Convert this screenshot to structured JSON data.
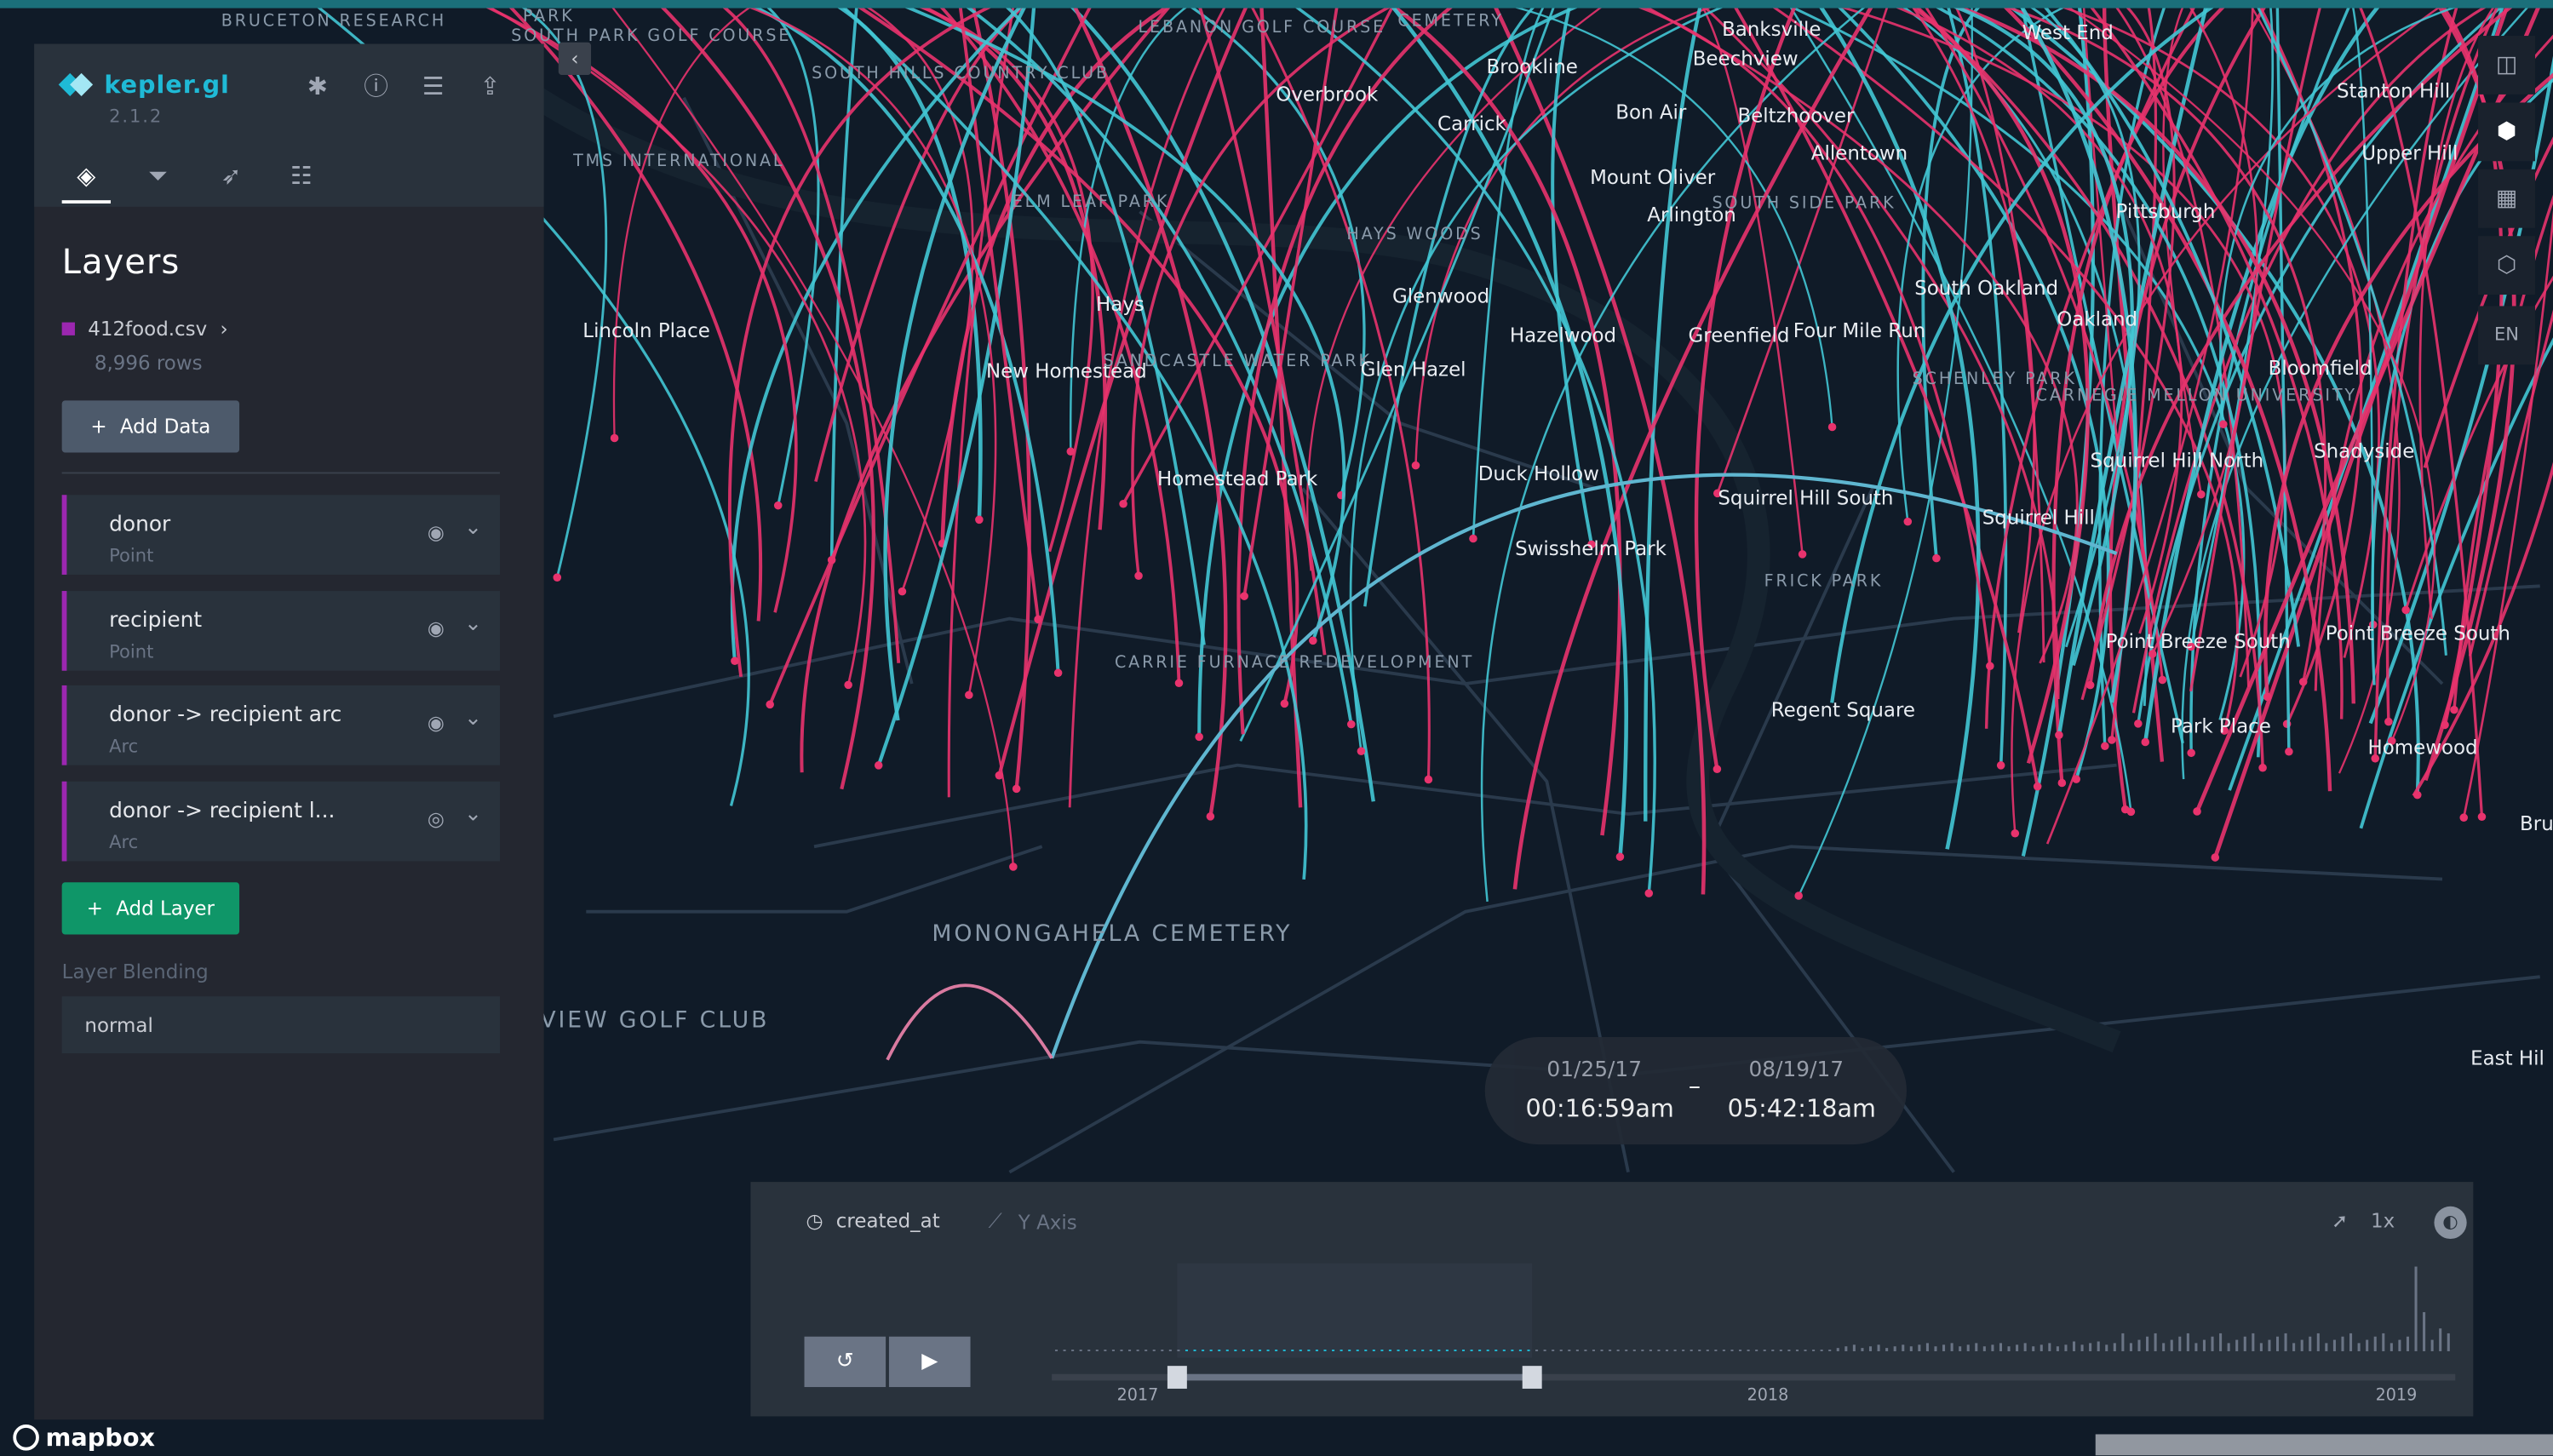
{
  "app": {
    "name": "kepler.gl",
    "version": "2.1.2"
  },
  "panel": {
    "title": "Layers",
    "tabs": [
      {
        "name": "layers-tab",
        "icon": "layers-icon"
      },
      {
        "name": "filters-tab",
        "icon": "filter-icon"
      },
      {
        "name": "interactions-tab",
        "icon": "cursor-icon"
      },
      {
        "name": "map-style-tab",
        "icon": "sliders-icon"
      }
    ],
    "dataset": {
      "name": "412food.csv",
      "rows": "8,996 rows",
      "color": "#9c27b0"
    },
    "add_data_label": "Add Data",
    "layers": [
      {
        "name": "donor",
        "type": "Point"
      },
      {
        "name": "recipient",
        "type": "Point"
      },
      {
        "name": "donor -> recipient arc",
        "type": "Arc"
      },
      {
        "name": "donor -> recipient l...",
        "type": "Arc"
      }
    ],
    "add_layer_label": "Add Layer",
    "blending_label": "Layer Blending",
    "blending_value": "normal"
  },
  "map_controls": [
    "split-map-icon",
    "3d-view-icon",
    "legend-icon",
    "draw-icon"
  ],
  "locale": "EN",
  "time_display": {
    "start_date": "01/25/17",
    "start_time": "00:16:59am",
    "end_date": "08/19/17",
    "end_time": "05:42:18am",
    "separator": "–"
  },
  "timeline": {
    "field": "created_at",
    "y_axis": "Y Axis",
    "speed": "1x",
    "years": [
      "2017",
      "2018",
      "2019"
    ]
  },
  "map_labels": [
    "BRUCETON RESEARCH",
    "PARK",
    "SOUTH PARK GOLF COURSE",
    "SOUTH HILLS COUNTRY CLUB",
    "LEBANON GOLF COURSE",
    "CEMETERY",
    "Brookline",
    "Banksville",
    "Beechview",
    "West End",
    "Overbrook",
    "Carrick",
    "Bon Air",
    "Beltzhoover",
    "TMS INTERNATIONAL",
    "Allentown",
    "Mount Oliver",
    "Arlington",
    "SOUTH SIDE PARK",
    "Pittsburgh",
    "ELM LEAF PARK",
    "HAYS WOODS",
    "Hays",
    "Glenwood",
    "Hazelwood",
    "Greenfield",
    "Four Mile Run",
    "Lincoln Place",
    "New Homestead",
    "SANDCASTLE WATER PARK",
    "Glen Hazel",
    "Homestead Park",
    "Duck Hollow",
    "Squirrel Hill South",
    "Squirrel Hill",
    "Swisshelm Park",
    "FRICK PARK",
    "CARRIE FURNACE REDEVELOPMENT",
    "Regent Square",
    "Point Breeze South",
    "Park Place",
    "Point Breeze South",
    "Homewood",
    "South Oakland",
    "Oakland",
    "SCHENLEY PARK",
    "CARNEGIE MELLON UNIVERSITY",
    "Bloomfield",
    "Squirrel Hill North",
    "Shadyside",
    "MONONGAHELA CEMETERY",
    "GRAND VIEW GOLF CLUB",
    "East Hil",
    "Bru",
    "Stanton Hill",
    "Upper Hill"
  ],
  "branding": "mapbox"
}
